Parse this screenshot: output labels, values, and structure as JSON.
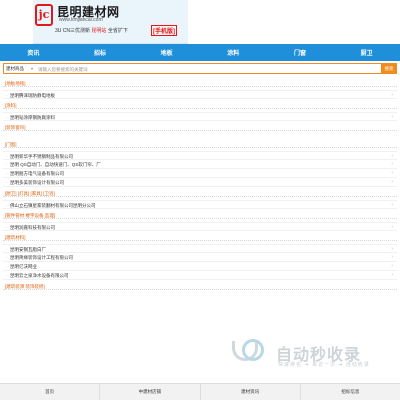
{
  "logo": {
    "title": "昆明建材网",
    "url": "www.kmjiancai.com",
    "tagline_parts": [
      "3U CN三优测新",
      "昆明站",
      "全省扩下"
    ],
    "mobile_label": "[手机版]"
  },
  "nav": [
    "资讯",
    "招标",
    "地板",
    "涂料",
    "门窗",
    "厨卫"
  ],
  "search": {
    "category": "建材商品",
    "placeholder": "请输入您要搜索的关键词",
    "button": "搜索"
  },
  "sections": [
    {
      "title": "[地板地毯]",
      "items": [
        "昆明腾泽瑞防静电地板"
      ]
    },
    {
      "title": "[涂料]",
      "items": [
        "昆明韬涂厚钢防腐涂料"
      ]
    },
    {
      "title": "[装饰窗帘]",
      "items": []
    },
    {
      "title": "[门窗]",
      "items": [
        "昆明新华手不锈钢制品有限公司",
        "昆明 QS自动门、自动快速门、QS软门帘、厂",
        "昆明朋方电气设备有限公司",
        "昆明多美装饰设计有限公司"
      ]
    },
    {
      "title": "[厨卫] [灯具] [家具] [卫浴]",
      "items": [
        "佛山立石镇星家装翻材有限公司昆明分公司"
      ]
    },
    {
      "title": "[管件管材 楼宇设备 监理]",
      "items": [
        "昆明润嘉科技有限公司"
      ]
    },
    {
      "title": "[建筑材料]",
      "items": [
        "昆明安钢瓦脂白厂",
        "昆明简缘装饰设计工程有限公司",
        "昆明亿沃网业",
        "昆明云之泉净水设备有限公司"
      ]
    },
    {
      "title": "[建筑装潢 装饰装修]",
      "items": []
    }
  ],
  "watermark": {
    "text": "自动秒收录",
    "sub": "快速排名 ➔ 来访一次 ➔ 自动收录"
  },
  "footer": [
    "首页",
    "中建材店铺",
    "建材资讯",
    "招标信息"
  ],
  "colors": {
    "nav_bg": "#1e8fd8",
    "accent_orange": "#f08c1e",
    "section_header": "#e05a00",
    "logo_red": "#e0191b"
  }
}
